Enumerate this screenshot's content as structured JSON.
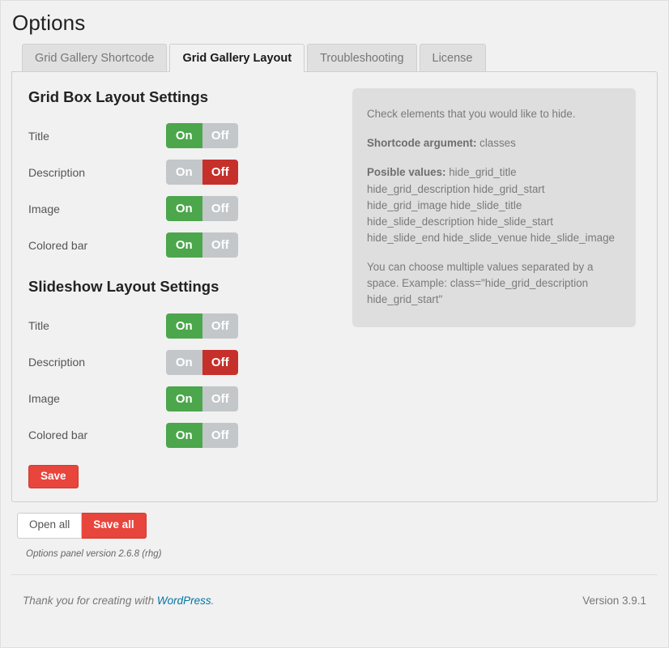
{
  "header": {
    "title": "Options"
  },
  "tabs": [
    {
      "label": "Grid Gallery Shortcode",
      "active": false
    },
    {
      "label": "Grid Gallery Layout",
      "active": true
    },
    {
      "label": "Troubleshooting",
      "active": false
    },
    {
      "label": "License",
      "active": false
    }
  ],
  "sections": [
    {
      "heading": "Grid Box Layout Settings",
      "rows": [
        {
          "label": "Title",
          "on_label": "On",
          "off_label": "Off",
          "state": "on"
        },
        {
          "label": "Description",
          "on_label": "On",
          "off_label": "Off",
          "state": "off"
        },
        {
          "label": "Image",
          "on_label": "On",
          "off_label": "Off",
          "state": "on"
        },
        {
          "label": "Colored bar",
          "on_label": "On",
          "off_label": "Off",
          "state": "on"
        }
      ]
    },
    {
      "heading": "Slideshow Layout Settings",
      "rows": [
        {
          "label": "Title",
          "on_label": "On",
          "off_label": "Off",
          "state": "on"
        },
        {
          "label": "Description",
          "on_label": "On",
          "off_label": "Off",
          "state": "off"
        },
        {
          "label": "Image",
          "on_label": "On",
          "off_label": "Off",
          "state": "on"
        },
        {
          "label": "Colored bar",
          "on_label": "On",
          "off_label": "Off",
          "state": "on"
        }
      ]
    }
  ],
  "info_box": {
    "intro": "Check elements that you would like to hide.",
    "shortcode_label": "Shortcode argument:",
    "shortcode_value": " classes",
    "possible_label": "Posible values:",
    "possible_value": " hide_grid_title hide_grid_description hide_grid_start hide_grid_image hide_slide_title hide_slide_description hide_slide_start hide_slide_end hide_slide_venue hide_slide_image",
    "note": "You can choose multiple values separated by a space. Example: class=\"hide_grid_description hide_grid_start\""
  },
  "buttons": {
    "save": "Save",
    "open_all": "Open all",
    "save_all": "Save all"
  },
  "version_note": "Options panel version 2.6.8 (rhg)",
  "footer": {
    "thanks_prefix": "Thank you for creating with ",
    "link_text": "WordPress",
    "thanks_suffix": ".",
    "version": "Version 3.9.1"
  },
  "colors": {
    "toggle_on": "#4ca64c",
    "toggle_off": "#c6302b",
    "toggle_inactive": "#c3c7ca",
    "button_red": "#e8453c",
    "link_blue": "#0074a2",
    "page_bg": "#f1f1f1",
    "info_bg": "#dedede"
  }
}
